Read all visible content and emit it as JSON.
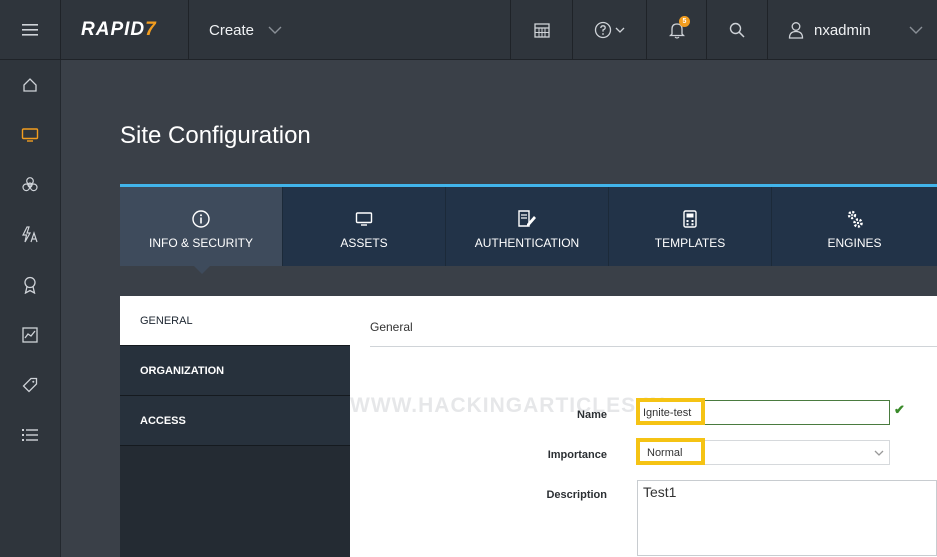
{
  "brand": {
    "logo_text": "RAPID",
    "logo_mark": "7",
    "accent": "#f29d1f"
  },
  "topbar": {
    "create_label": "Create",
    "notification_count": "5",
    "username": "nxadmin"
  },
  "leftnav": {
    "icons": [
      "home-icon",
      "monitor-icon",
      "biohazard-icon",
      "flash-a-icon",
      "award-icon",
      "chart-icon",
      "tag-icon",
      "list-icon"
    ],
    "active": "monitor-icon"
  },
  "page": {
    "title": "Site Configuration"
  },
  "tabs": [
    {
      "label": "INFO & SECURITY",
      "icon": "info-icon",
      "active": true
    },
    {
      "label": "ASSETS",
      "icon": "monitor-icon",
      "active": false
    },
    {
      "label": "AUTHENTICATION",
      "icon": "edit-document-icon",
      "active": false
    },
    {
      "label": "TEMPLATES",
      "icon": "calculator-icon",
      "active": false
    },
    {
      "label": "ENGINES",
      "icon": "gears-icon",
      "active": false
    }
  ],
  "subnav": [
    {
      "label": "GENERAL",
      "active": true
    },
    {
      "label": "ORGANIZATION",
      "active": false
    },
    {
      "label": "ACCESS",
      "active": false
    }
  ],
  "panel": {
    "header": "General",
    "watermark": "WWW.HACKINGARTICLES.IN",
    "fields": {
      "name_label": "Name",
      "name_value": "Ignite-test",
      "importance_label": "Importance",
      "importance_value": "Normal",
      "description_label": "Description",
      "description_value": "Test1"
    }
  },
  "colors": {
    "tab_accent": "#41b4ea",
    "highlight": "#f5c314",
    "valid": "#3a8a2a"
  }
}
